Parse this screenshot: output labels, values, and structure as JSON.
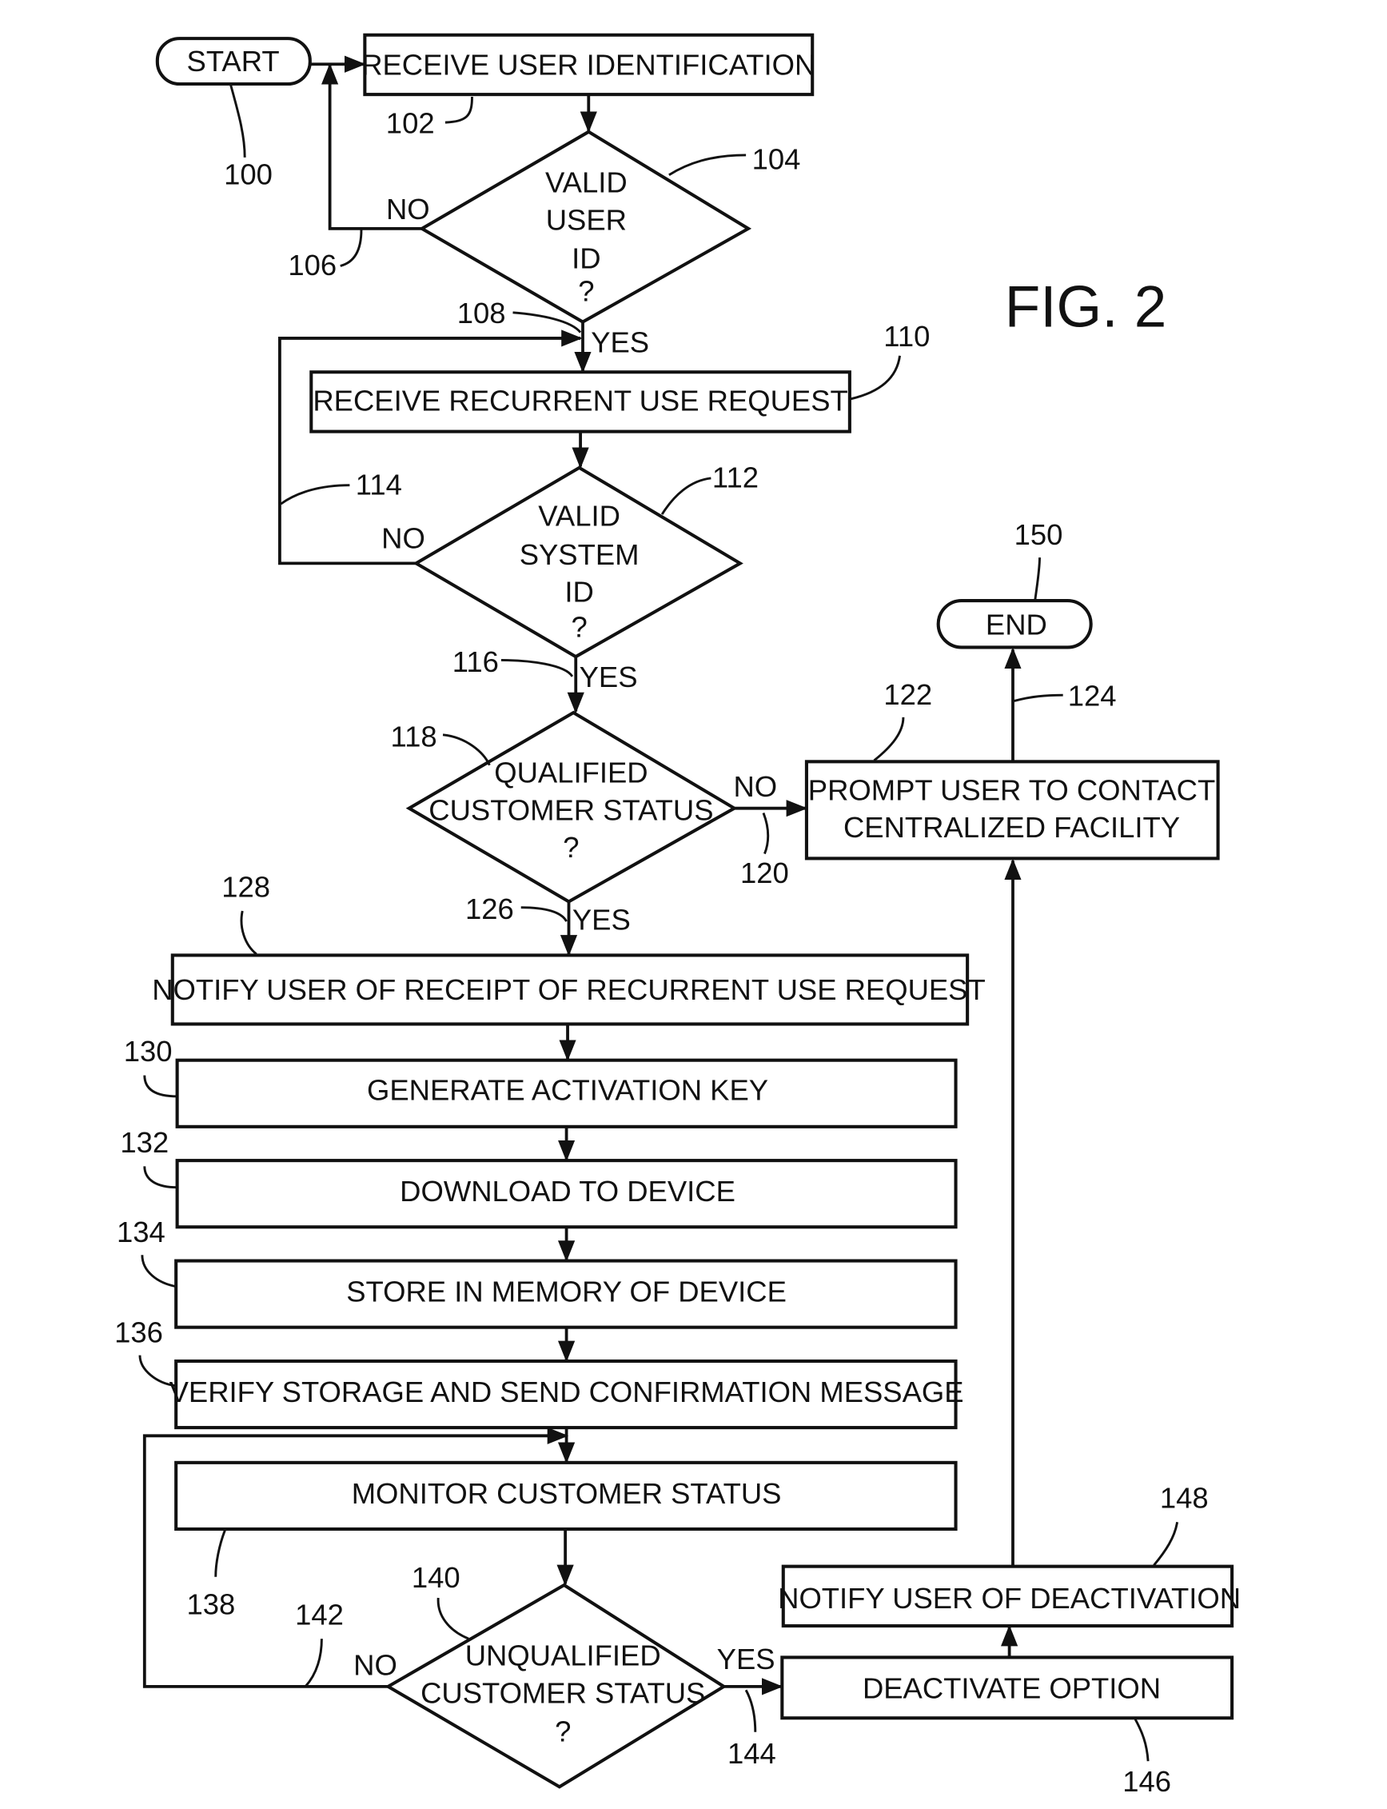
{
  "figure": {
    "title": "FIG. 2"
  },
  "nodes": {
    "start": {
      "ref": "100",
      "label": "START"
    },
    "receive_user_id": {
      "ref": "102",
      "label": "RECEIVE USER IDENTIFICATION"
    },
    "valid_user_id": {
      "ref": "104",
      "lines": [
        "VALID",
        "USER",
        "ID",
        "?"
      ]
    },
    "receive_recurrent": {
      "ref": "110",
      "label": "RECEIVE RECURRENT USE REQUEST"
    },
    "valid_system_id": {
      "ref": "112",
      "lines": [
        "VALID",
        "SYSTEM",
        "ID",
        "?"
      ]
    },
    "qualified_status": {
      "ref": "118",
      "lines": [
        "QUALIFIED",
        "CUSTOMER STATUS",
        "?"
      ]
    },
    "prompt_contact": {
      "ref": "122",
      "lines": [
        "PROMPT USER TO CONTACT",
        "CENTRALIZED FACILITY"
      ]
    },
    "end": {
      "ref": "150",
      "label": "END"
    },
    "notify_receipt": {
      "ref": "128",
      "label": "NOTIFY USER OF RECEIPT OF RECURRENT USE REQUEST"
    },
    "generate_key": {
      "ref": "130",
      "label": "GENERATE ACTIVATION KEY"
    },
    "download": {
      "ref": "132",
      "label": "DOWNLOAD TO DEVICE"
    },
    "store": {
      "ref": "134",
      "label": "STORE IN MEMORY OF DEVICE"
    },
    "verify": {
      "ref": "136",
      "label": "VERIFY STORAGE AND SEND CONFIRMATION MESSAGE"
    },
    "monitor": {
      "ref": "138",
      "label": "MONITOR CUSTOMER STATUS"
    },
    "unqualified_status": {
      "ref": "140",
      "lines": [
        "UNQUALIFIED",
        "CUSTOMER STATUS",
        "?"
      ]
    },
    "deactivate": {
      "ref": "146",
      "label": "DEACTIVATE OPTION"
    },
    "notify_deactivation": {
      "ref": "148",
      "label": "NOTIFY USER OF DEACTIVATION"
    }
  },
  "edges": {
    "e106": {
      "ref": "106",
      "label": "NO"
    },
    "e108": {
      "ref": "108",
      "label": "YES"
    },
    "e114": {
      "ref": "114",
      "label": "NO"
    },
    "e116": {
      "ref": "116",
      "label": "YES"
    },
    "e120": {
      "ref": "120",
      "label": "NO"
    },
    "e124": {
      "ref": "124"
    },
    "e126": {
      "ref": "126",
      "label": "YES"
    },
    "e142": {
      "ref": "142",
      "label": "NO"
    },
    "e144": {
      "ref": "144",
      "label": "YES"
    }
  }
}
